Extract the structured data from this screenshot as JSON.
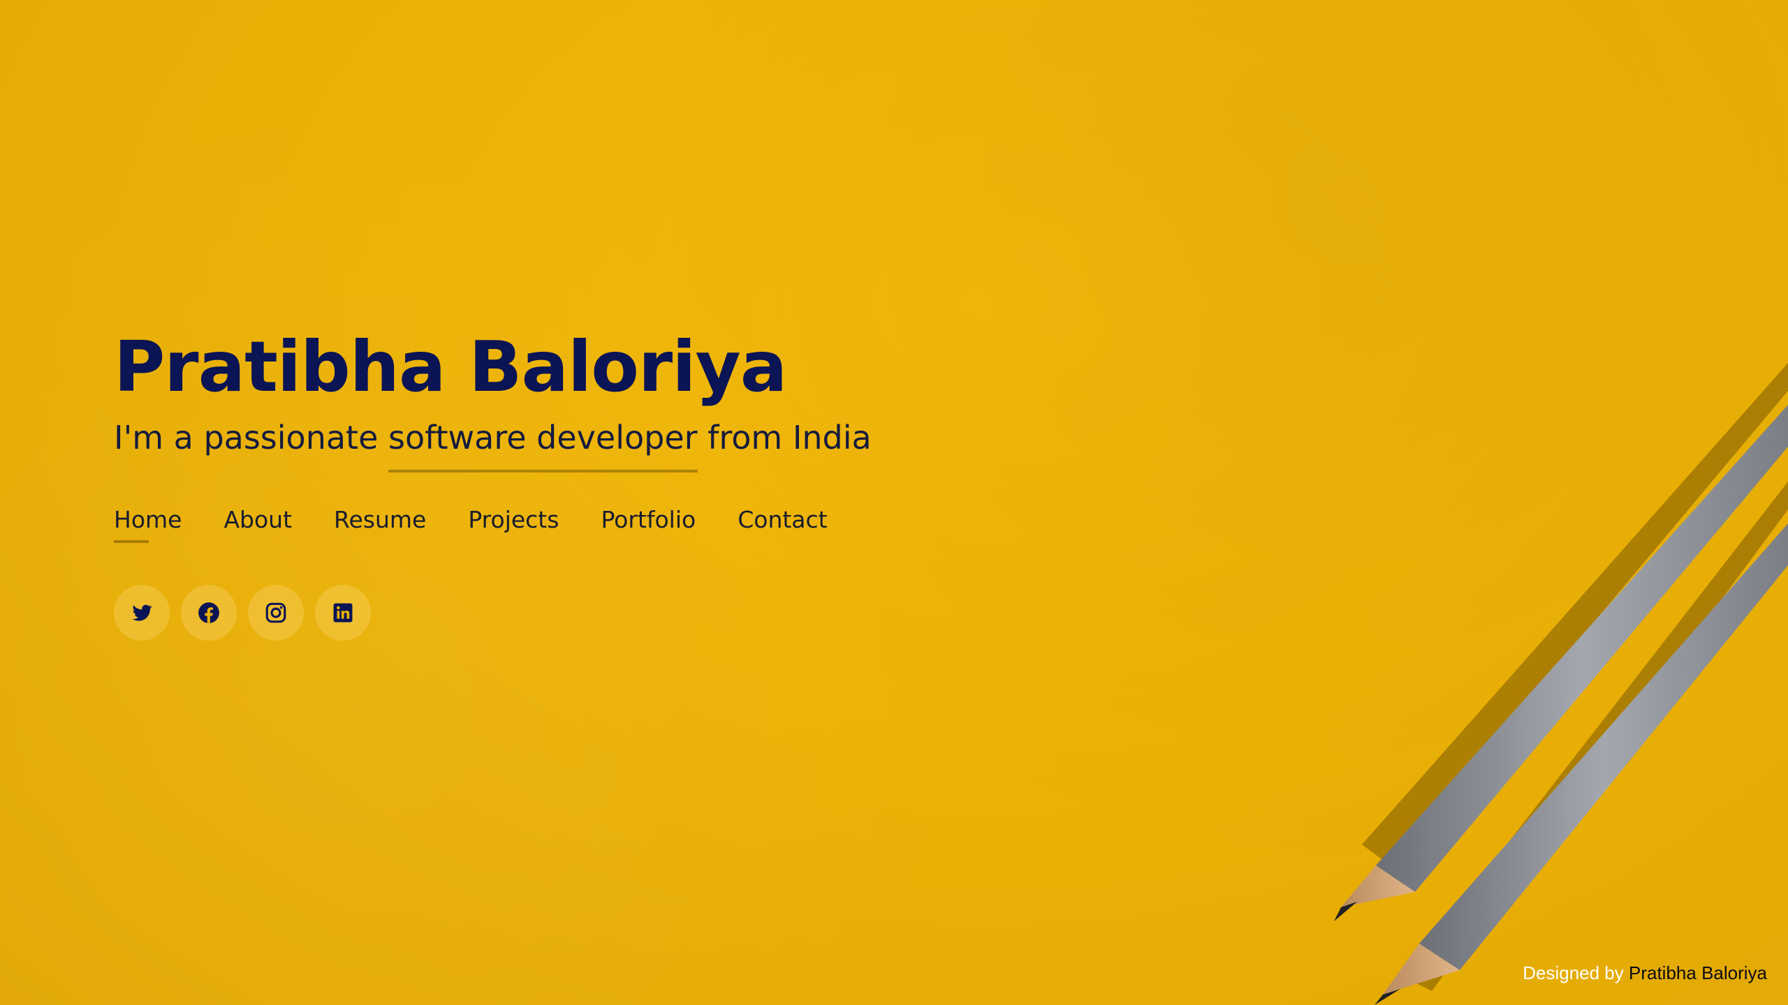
{
  "hero": {
    "name": "Pratibha Baloriya",
    "tagline_prefix": "I'm a passionate ",
    "tagline_role": "software developer",
    "tagline_suffix": " from India"
  },
  "nav": {
    "items": [
      {
        "label": "Home",
        "active": true
      },
      {
        "label": "About",
        "active": false
      },
      {
        "label": "Resume",
        "active": false
      },
      {
        "label": "Projects",
        "active": false
      },
      {
        "label": "Portfolio",
        "active": false
      },
      {
        "label": "Contact",
        "active": false
      }
    ]
  },
  "social": {
    "icons": [
      "twitter-icon",
      "facebook-icon",
      "instagram-icon",
      "linkedin-icon"
    ]
  },
  "footer": {
    "prefix": "Designed by ",
    "author": "Pratibha Baloriya"
  },
  "colors": {
    "background": "#ecb206",
    "name": "#0b1454",
    "text": "#171c2e",
    "footer_text": "#ffffff"
  }
}
